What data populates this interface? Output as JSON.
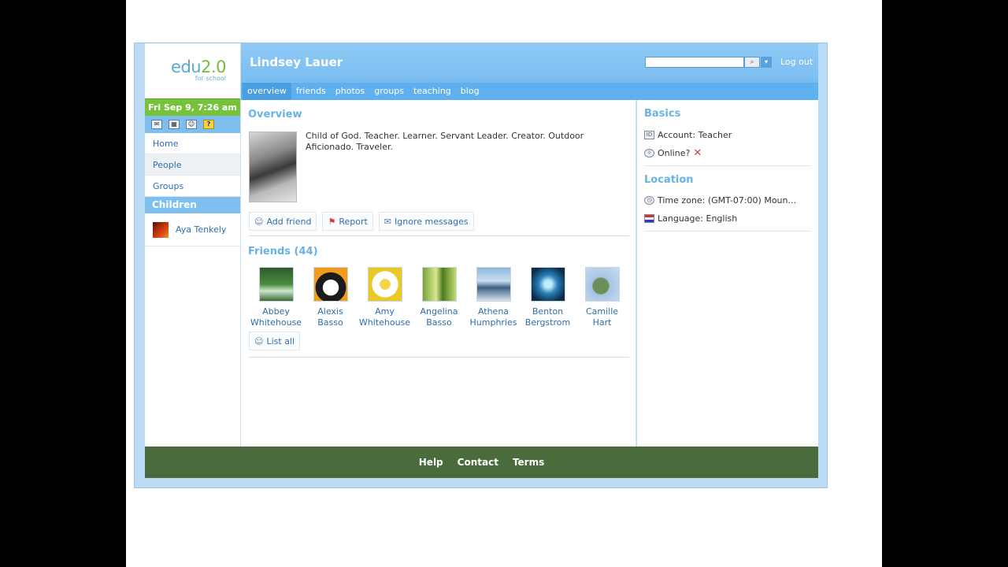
{
  "logo": {
    "brand_main": "edu",
    "brand_num": "2.0",
    "sub": "for school"
  },
  "sidebar": {
    "datetime": "Fri Sep 9, 7:26 am",
    "icons": [
      "mail-icon",
      "calendar-icon",
      "people-icon",
      "help-icon"
    ],
    "items": [
      {
        "label": "Home"
      },
      {
        "label": "People"
      },
      {
        "label": "Groups"
      }
    ],
    "children_heading": "Children",
    "children": [
      {
        "name": "Aya Tenkely"
      }
    ]
  },
  "header": {
    "name": "Lindsey Lauer",
    "search": {
      "value": "",
      "placeholder": ""
    },
    "logout": "Log out",
    "tabs": [
      {
        "label": "overview",
        "active": true
      },
      {
        "label": "friends"
      },
      {
        "label": "photos"
      },
      {
        "label": "groups"
      },
      {
        "label": "teaching"
      },
      {
        "label": "blog"
      }
    ]
  },
  "overview": {
    "title": "Overview",
    "bio": "Child of God. Teacher. Learner. Servant Leader. Creator. Outdoor Aficionado. Traveler.",
    "actions": {
      "add_friend": "Add friend",
      "report": "Report",
      "ignore": "Ignore messages"
    }
  },
  "friends": {
    "title": "Friends (44)",
    "list": [
      {
        "first": "Abbey",
        "last": "Whitehouse"
      },
      {
        "first": "Alexis",
        "last": "Basso"
      },
      {
        "first": "Amy",
        "last": "Whitehouse"
      },
      {
        "first": "Angelina",
        "last": "Basso"
      },
      {
        "first": "Athena",
        "last": "Humphries"
      },
      {
        "first": "Benton",
        "last": "Bergstrom"
      },
      {
        "first": "Camille",
        "last": "Hart"
      }
    ],
    "list_all": "List all"
  },
  "basics": {
    "title": "Basics",
    "account": "Account: Teacher",
    "online": "Online?"
  },
  "location": {
    "title": "Location",
    "timezone": "Time zone: (GMT-07:00) Moun...",
    "language": "Language: English"
  },
  "footer": {
    "links": [
      "Help",
      "Contact",
      "Terms"
    ]
  },
  "colors": {
    "header_blue": "#6fb7ee",
    "datebar_green": "#76c23a",
    "footer_green": "#4a6b3c",
    "link_blue": "#2a6fae"
  }
}
